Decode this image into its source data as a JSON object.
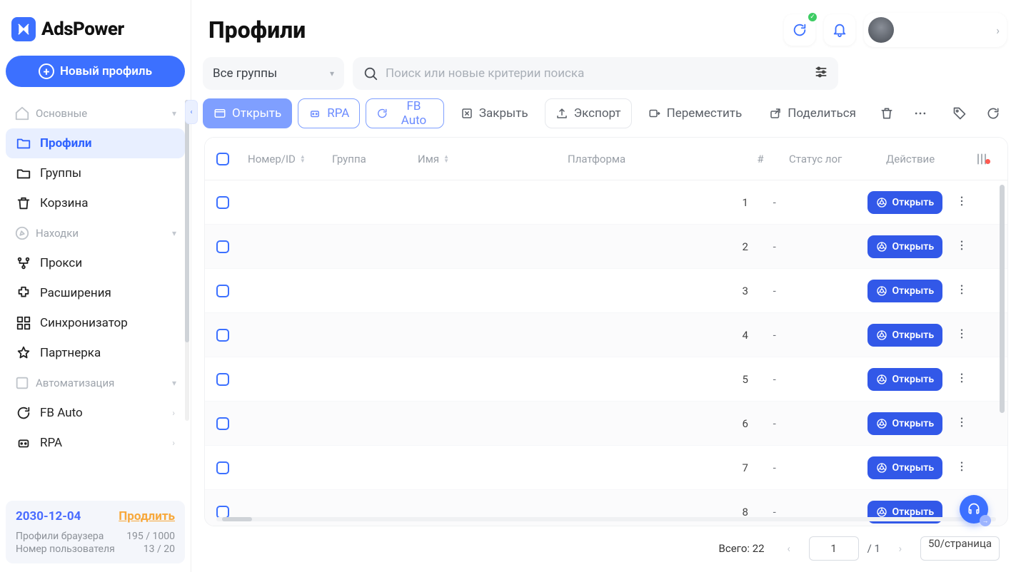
{
  "brand": {
    "name": "AdsPower"
  },
  "sidebar": {
    "new_profile_label": "Новый профиль",
    "sections": {
      "main_title": "Основные",
      "find_title": "Находки",
      "auto_title": "Автоматизация"
    },
    "items": {
      "profiles": "Профили",
      "groups": "Группы",
      "trash": "Корзина",
      "proxy": "Прокси",
      "extensions": "Расширения",
      "sync": "Синхронизатор",
      "affiliate": "Партнерка",
      "fbauto": "FB Auto",
      "rpa": "RPA"
    }
  },
  "license": {
    "date": "2030-12-04",
    "renew": "Продлить",
    "profiles_label": "Профили браузера",
    "profiles_value": "195 / 1000",
    "users_label": "Номер пользователя",
    "users_value": "13 / 20"
  },
  "header": {
    "title": "Профили"
  },
  "filters": {
    "group_label": "Все группы",
    "search_placeholder": "Поиск или новые критерии поиска"
  },
  "toolbar": {
    "open": "Открыть",
    "rpa": "RPA",
    "fbauto": "FB Auto",
    "close": "Закрыть",
    "export": "Экспорт",
    "move": "Переместить",
    "share": "Поделиться"
  },
  "table": {
    "headers": {
      "number_id": "Номер/ID",
      "group": "Группа",
      "name": "Имя",
      "platform": "Платформа",
      "hash": "#",
      "login_status": "Статус лог",
      "action": "Действие"
    },
    "open_label": "Открыть",
    "rows": [
      {
        "num": "1",
        "login": "-"
      },
      {
        "num": "2",
        "login": "-"
      },
      {
        "num": "3",
        "login": "-"
      },
      {
        "num": "4",
        "login": "-"
      },
      {
        "num": "5",
        "login": "-"
      },
      {
        "num": "6",
        "login": "-"
      },
      {
        "num": "7",
        "login": "-"
      },
      {
        "num": "8",
        "login": "-"
      }
    ]
  },
  "pager": {
    "total_label": "Всего: 22",
    "page_value": "1",
    "pages_suffix": "/ 1",
    "per_page": "50/страница"
  }
}
